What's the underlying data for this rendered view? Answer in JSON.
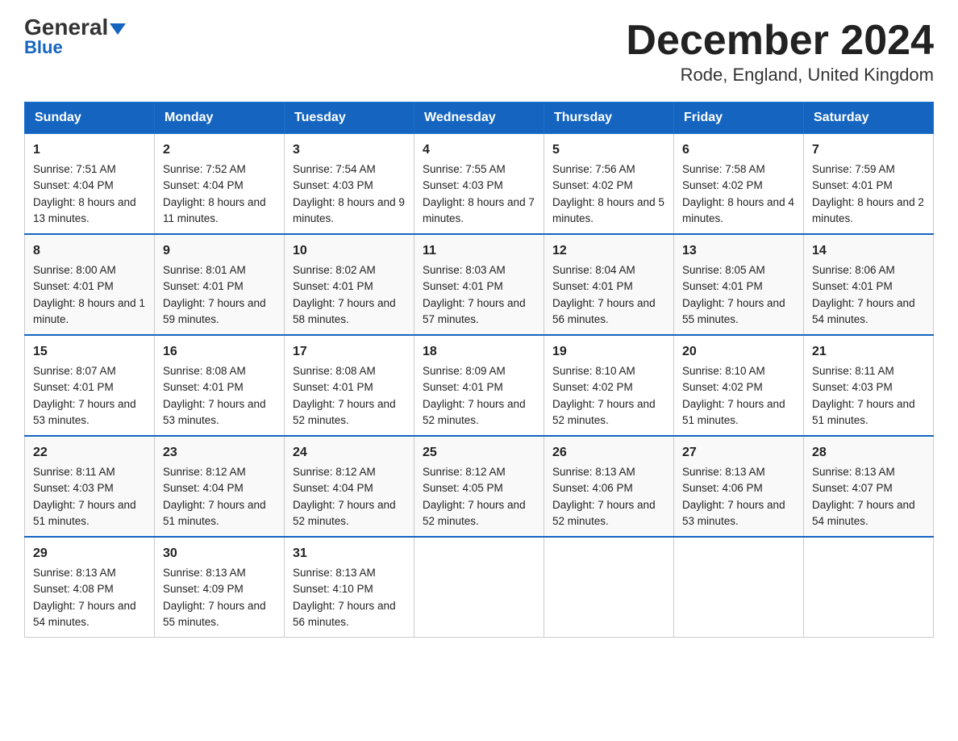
{
  "header": {
    "logo_general": "General",
    "logo_blue": "Blue",
    "title": "December 2024",
    "subtitle": "Rode, England, United Kingdom"
  },
  "columns": [
    "Sunday",
    "Monday",
    "Tuesday",
    "Wednesday",
    "Thursday",
    "Friday",
    "Saturday"
  ],
  "weeks": [
    [
      {
        "day": "1",
        "sunrise": "Sunrise: 7:51 AM",
        "sunset": "Sunset: 4:04 PM",
        "daylight": "Daylight: 8 hours and 13 minutes."
      },
      {
        "day": "2",
        "sunrise": "Sunrise: 7:52 AM",
        "sunset": "Sunset: 4:04 PM",
        "daylight": "Daylight: 8 hours and 11 minutes."
      },
      {
        "day": "3",
        "sunrise": "Sunrise: 7:54 AM",
        "sunset": "Sunset: 4:03 PM",
        "daylight": "Daylight: 8 hours and 9 minutes."
      },
      {
        "day": "4",
        "sunrise": "Sunrise: 7:55 AM",
        "sunset": "Sunset: 4:03 PM",
        "daylight": "Daylight: 8 hours and 7 minutes."
      },
      {
        "day": "5",
        "sunrise": "Sunrise: 7:56 AM",
        "sunset": "Sunset: 4:02 PM",
        "daylight": "Daylight: 8 hours and 5 minutes."
      },
      {
        "day": "6",
        "sunrise": "Sunrise: 7:58 AM",
        "sunset": "Sunset: 4:02 PM",
        "daylight": "Daylight: 8 hours and 4 minutes."
      },
      {
        "day": "7",
        "sunrise": "Sunrise: 7:59 AM",
        "sunset": "Sunset: 4:01 PM",
        "daylight": "Daylight: 8 hours and 2 minutes."
      }
    ],
    [
      {
        "day": "8",
        "sunrise": "Sunrise: 8:00 AM",
        "sunset": "Sunset: 4:01 PM",
        "daylight": "Daylight: 8 hours and 1 minute."
      },
      {
        "day": "9",
        "sunrise": "Sunrise: 8:01 AM",
        "sunset": "Sunset: 4:01 PM",
        "daylight": "Daylight: 7 hours and 59 minutes."
      },
      {
        "day": "10",
        "sunrise": "Sunrise: 8:02 AM",
        "sunset": "Sunset: 4:01 PM",
        "daylight": "Daylight: 7 hours and 58 minutes."
      },
      {
        "day": "11",
        "sunrise": "Sunrise: 8:03 AM",
        "sunset": "Sunset: 4:01 PM",
        "daylight": "Daylight: 7 hours and 57 minutes."
      },
      {
        "day": "12",
        "sunrise": "Sunrise: 8:04 AM",
        "sunset": "Sunset: 4:01 PM",
        "daylight": "Daylight: 7 hours and 56 minutes."
      },
      {
        "day": "13",
        "sunrise": "Sunrise: 8:05 AM",
        "sunset": "Sunset: 4:01 PM",
        "daylight": "Daylight: 7 hours and 55 minutes."
      },
      {
        "day": "14",
        "sunrise": "Sunrise: 8:06 AM",
        "sunset": "Sunset: 4:01 PM",
        "daylight": "Daylight: 7 hours and 54 minutes."
      }
    ],
    [
      {
        "day": "15",
        "sunrise": "Sunrise: 8:07 AM",
        "sunset": "Sunset: 4:01 PM",
        "daylight": "Daylight: 7 hours and 53 minutes."
      },
      {
        "day": "16",
        "sunrise": "Sunrise: 8:08 AM",
        "sunset": "Sunset: 4:01 PM",
        "daylight": "Daylight: 7 hours and 53 minutes."
      },
      {
        "day": "17",
        "sunrise": "Sunrise: 8:08 AM",
        "sunset": "Sunset: 4:01 PM",
        "daylight": "Daylight: 7 hours and 52 minutes."
      },
      {
        "day": "18",
        "sunrise": "Sunrise: 8:09 AM",
        "sunset": "Sunset: 4:01 PM",
        "daylight": "Daylight: 7 hours and 52 minutes."
      },
      {
        "day": "19",
        "sunrise": "Sunrise: 8:10 AM",
        "sunset": "Sunset: 4:02 PM",
        "daylight": "Daylight: 7 hours and 52 minutes."
      },
      {
        "day": "20",
        "sunrise": "Sunrise: 8:10 AM",
        "sunset": "Sunset: 4:02 PM",
        "daylight": "Daylight: 7 hours and 51 minutes."
      },
      {
        "day": "21",
        "sunrise": "Sunrise: 8:11 AM",
        "sunset": "Sunset: 4:03 PM",
        "daylight": "Daylight: 7 hours and 51 minutes."
      }
    ],
    [
      {
        "day": "22",
        "sunrise": "Sunrise: 8:11 AM",
        "sunset": "Sunset: 4:03 PM",
        "daylight": "Daylight: 7 hours and 51 minutes."
      },
      {
        "day": "23",
        "sunrise": "Sunrise: 8:12 AM",
        "sunset": "Sunset: 4:04 PM",
        "daylight": "Daylight: 7 hours and 51 minutes."
      },
      {
        "day": "24",
        "sunrise": "Sunrise: 8:12 AM",
        "sunset": "Sunset: 4:04 PM",
        "daylight": "Daylight: 7 hours and 52 minutes."
      },
      {
        "day": "25",
        "sunrise": "Sunrise: 8:12 AM",
        "sunset": "Sunset: 4:05 PM",
        "daylight": "Daylight: 7 hours and 52 minutes."
      },
      {
        "day": "26",
        "sunrise": "Sunrise: 8:13 AM",
        "sunset": "Sunset: 4:06 PM",
        "daylight": "Daylight: 7 hours and 52 minutes."
      },
      {
        "day": "27",
        "sunrise": "Sunrise: 8:13 AM",
        "sunset": "Sunset: 4:06 PM",
        "daylight": "Daylight: 7 hours and 53 minutes."
      },
      {
        "day": "28",
        "sunrise": "Sunrise: 8:13 AM",
        "sunset": "Sunset: 4:07 PM",
        "daylight": "Daylight: 7 hours and 54 minutes."
      }
    ],
    [
      {
        "day": "29",
        "sunrise": "Sunrise: 8:13 AM",
        "sunset": "Sunset: 4:08 PM",
        "daylight": "Daylight: 7 hours and 54 minutes."
      },
      {
        "day": "30",
        "sunrise": "Sunrise: 8:13 AM",
        "sunset": "Sunset: 4:09 PM",
        "daylight": "Daylight: 7 hours and 55 minutes."
      },
      {
        "day": "31",
        "sunrise": "Sunrise: 8:13 AM",
        "sunset": "Sunset: 4:10 PM",
        "daylight": "Daylight: 7 hours and 56 minutes."
      },
      null,
      null,
      null,
      null
    ]
  ]
}
